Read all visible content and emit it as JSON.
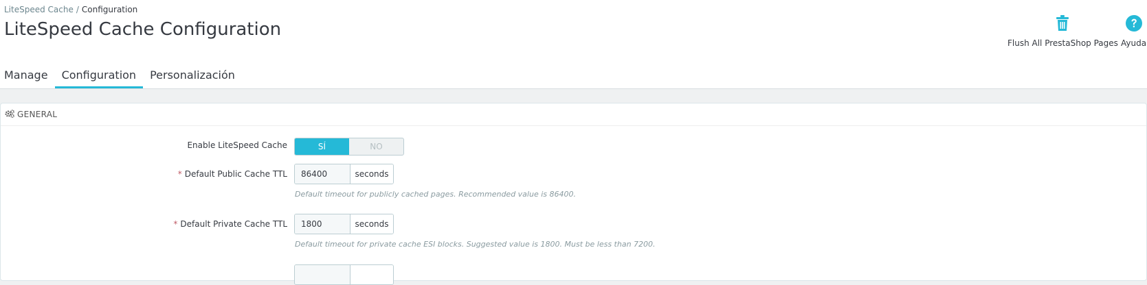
{
  "breadcrumb": {
    "parent": "LiteSpeed Cache",
    "separator": "/",
    "current": "Configuration"
  },
  "page_title": "LiteSpeed Cache Configuration",
  "toolbar": {
    "flush": {
      "label": "Flush All PrestaShop Pages",
      "icon": "trash-icon"
    },
    "help": {
      "label": "Ayuda",
      "icon": "question-circle-icon"
    }
  },
  "tabs": [
    {
      "label": "Manage",
      "active": false
    },
    {
      "label": "Configuration",
      "active": true
    },
    {
      "label": "Personalización",
      "active": false
    }
  ],
  "panel": {
    "heading": "GENERAL",
    "heading_icon": "cogs-icon",
    "fields": {
      "enable": {
        "label": "Enable LiteSpeed Cache",
        "on_label": "SÍ",
        "off_label": "NO",
        "value": "on"
      },
      "public_ttl": {
        "required_mark": "*",
        "label": "Default Public Cache TTL",
        "value": "86400",
        "unit": "seconds",
        "help": "Default timeout for publicly cached pages. Recommended value is 86400."
      },
      "private_ttl": {
        "required_mark": "*",
        "label": "Default Private Cache TTL",
        "value": "1800",
        "unit": "seconds",
        "help": "Default timeout for private cache ESI blocks. Suggested value is 1800. Must be less than 7200."
      }
    }
  },
  "colors": {
    "accent": "#25b9d7",
    "required": "#c05c67",
    "text": "#363a41",
    "muted": "#6c868e"
  }
}
